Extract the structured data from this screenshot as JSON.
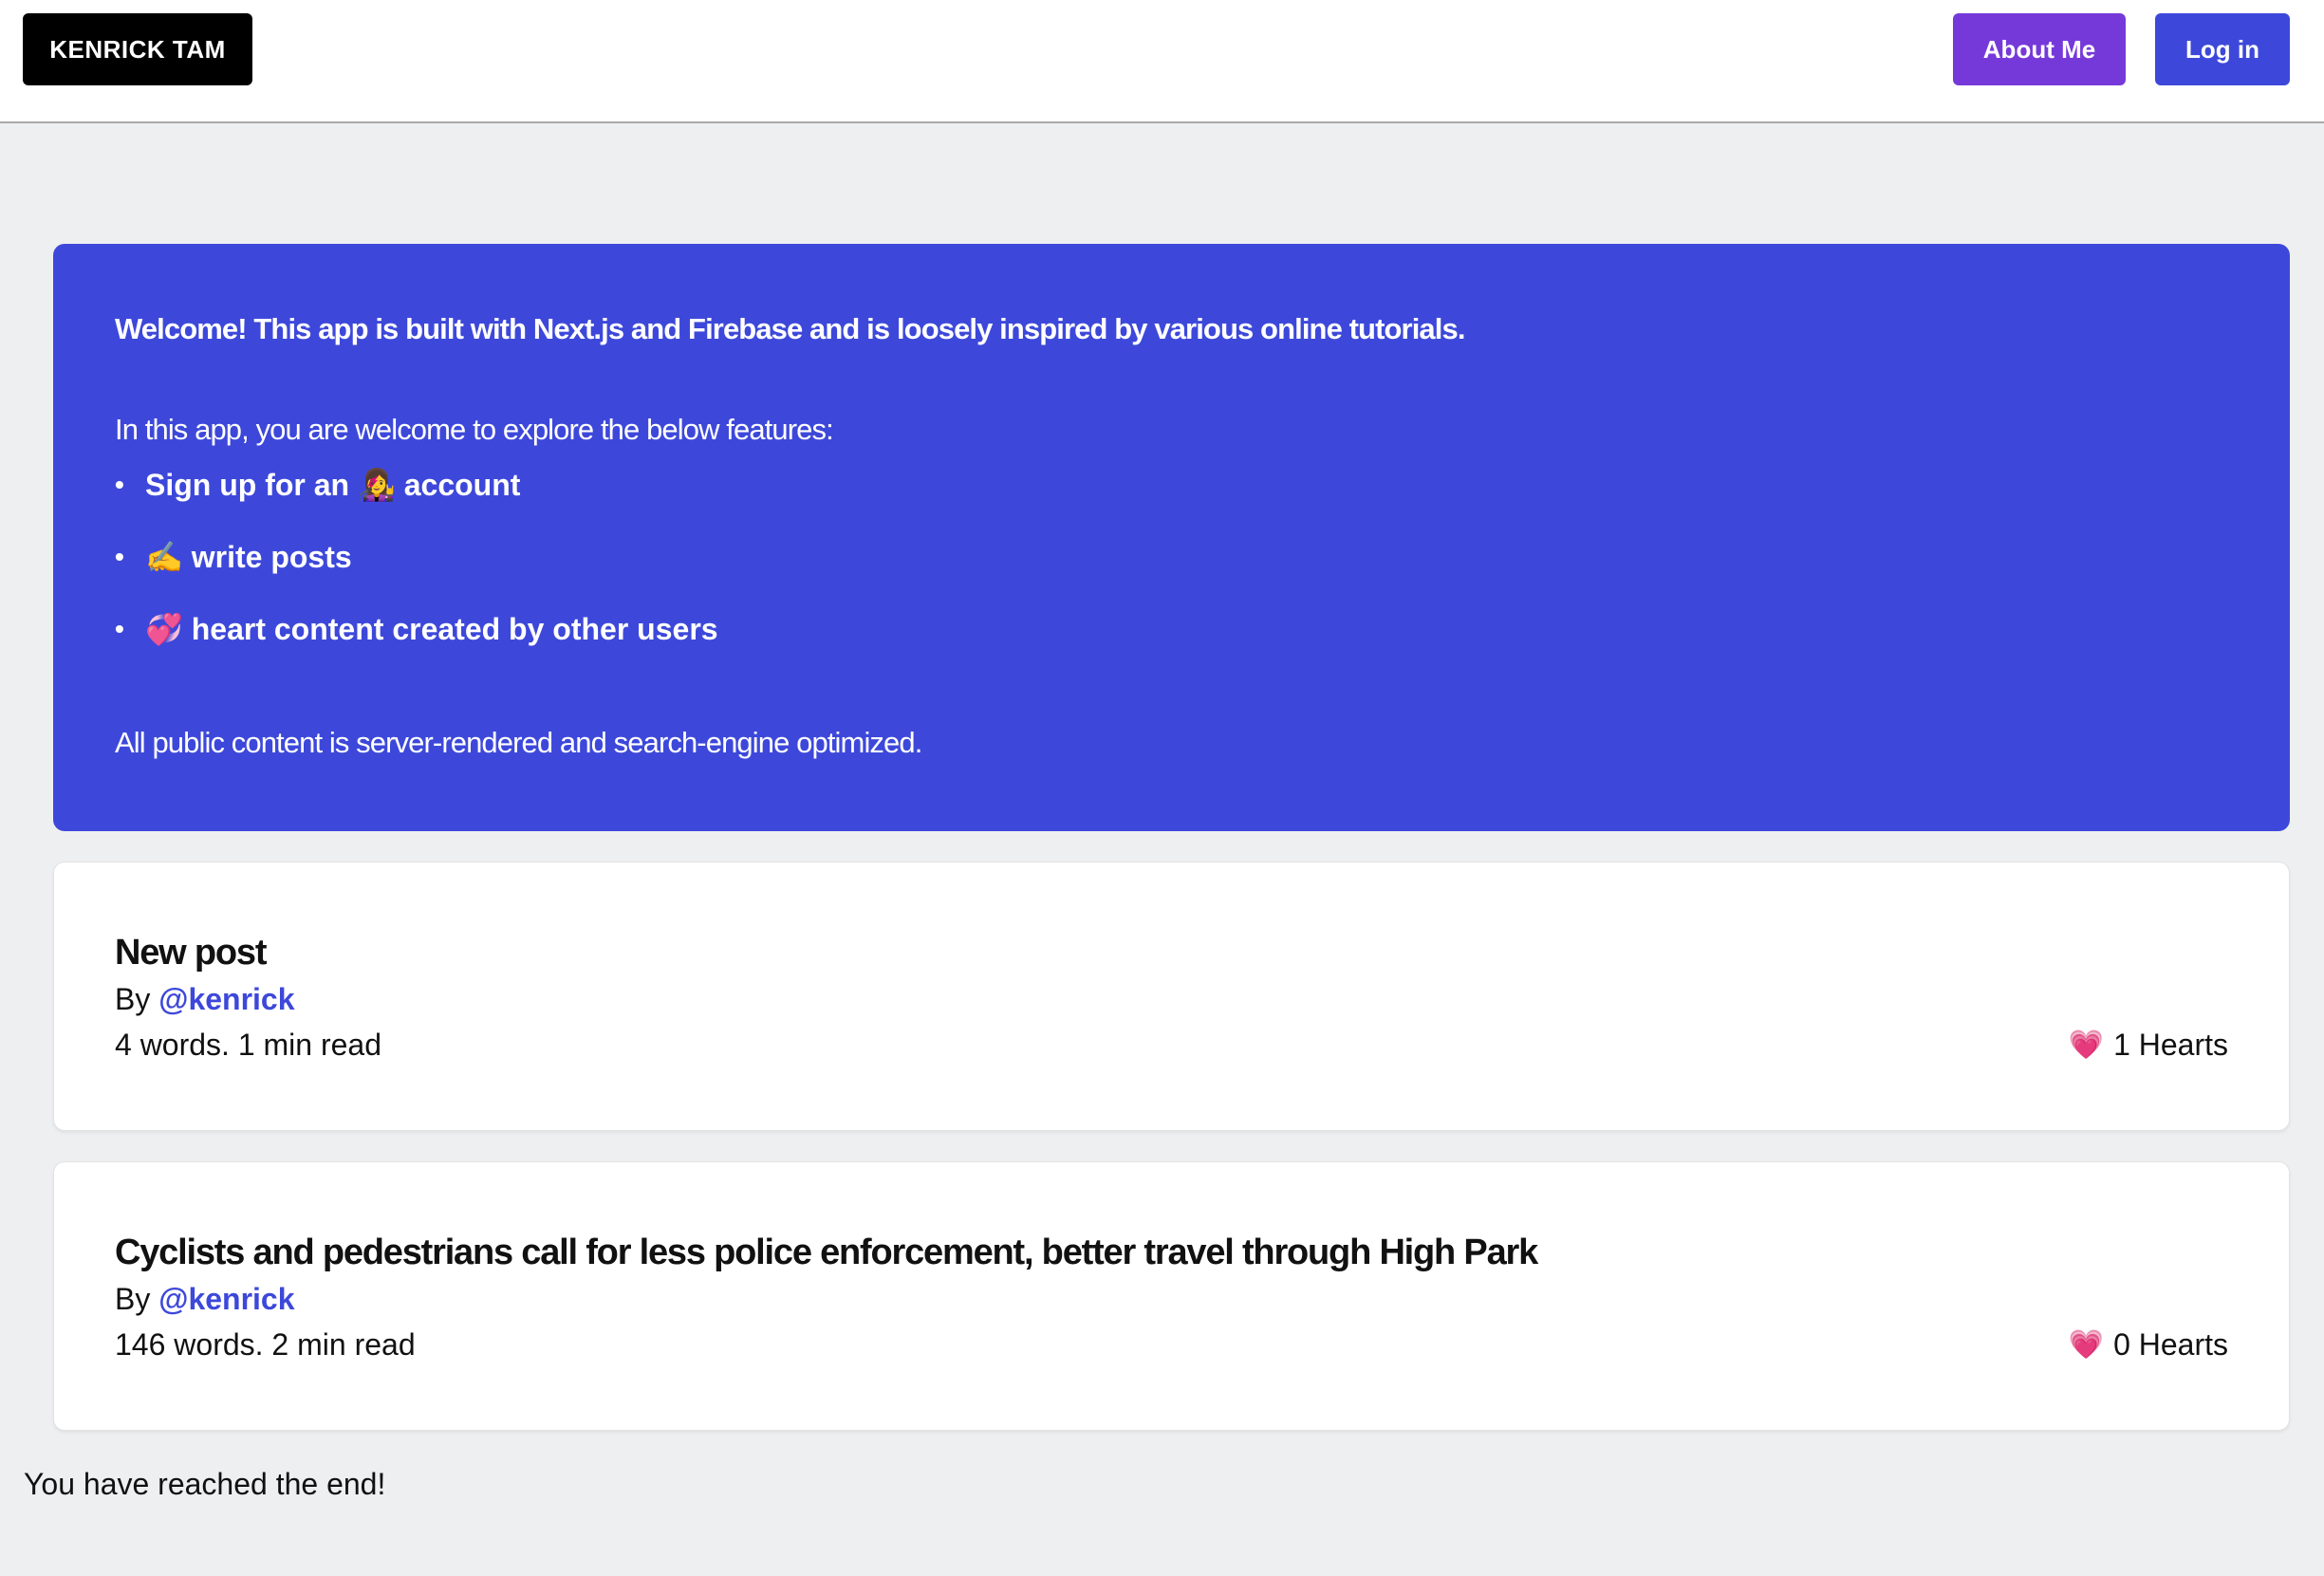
{
  "nav": {
    "brand": "KENRICK TAM",
    "about_label": "About Me",
    "login_label": "Log in"
  },
  "hero": {
    "welcome": "Welcome! This app is built with Next.js and Firebase and is loosely inspired by various online tutorials.",
    "intro": "In this app, you are welcome to explore the below features:",
    "features": [
      {
        "text": "Sign up for an 👩‍🎤 account"
      },
      {
        "text": "✍️ write posts"
      },
      {
        "text": "💞 heart content created by other users"
      }
    ],
    "note": "All public content is server-rendered and search-engine optimized."
  },
  "posts": [
    {
      "title": "New post",
      "by_label": "By",
      "author": "@kenrick",
      "meta": "4 words. 1 min read",
      "hearts": "1 Hearts",
      "heart_icon": "heart-icon"
    },
    {
      "title": "Cyclists and pedestrians call for less police enforcement, better travel through High Park",
      "by_label": "By",
      "author": "@kenrick",
      "meta": "146 words. 2 min read",
      "hearts": "0 Hearts",
      "heart_icon": "heart-icon"
    }
  ],
  "footer": {
    "end_text": "You have reached the end!"
  },
  "colors": {
    "primary": "#3d48da",
    "about_button": "#7639d9",
    "brand_button": "#000000",
    "background": "#eeeff1"
  }
}
